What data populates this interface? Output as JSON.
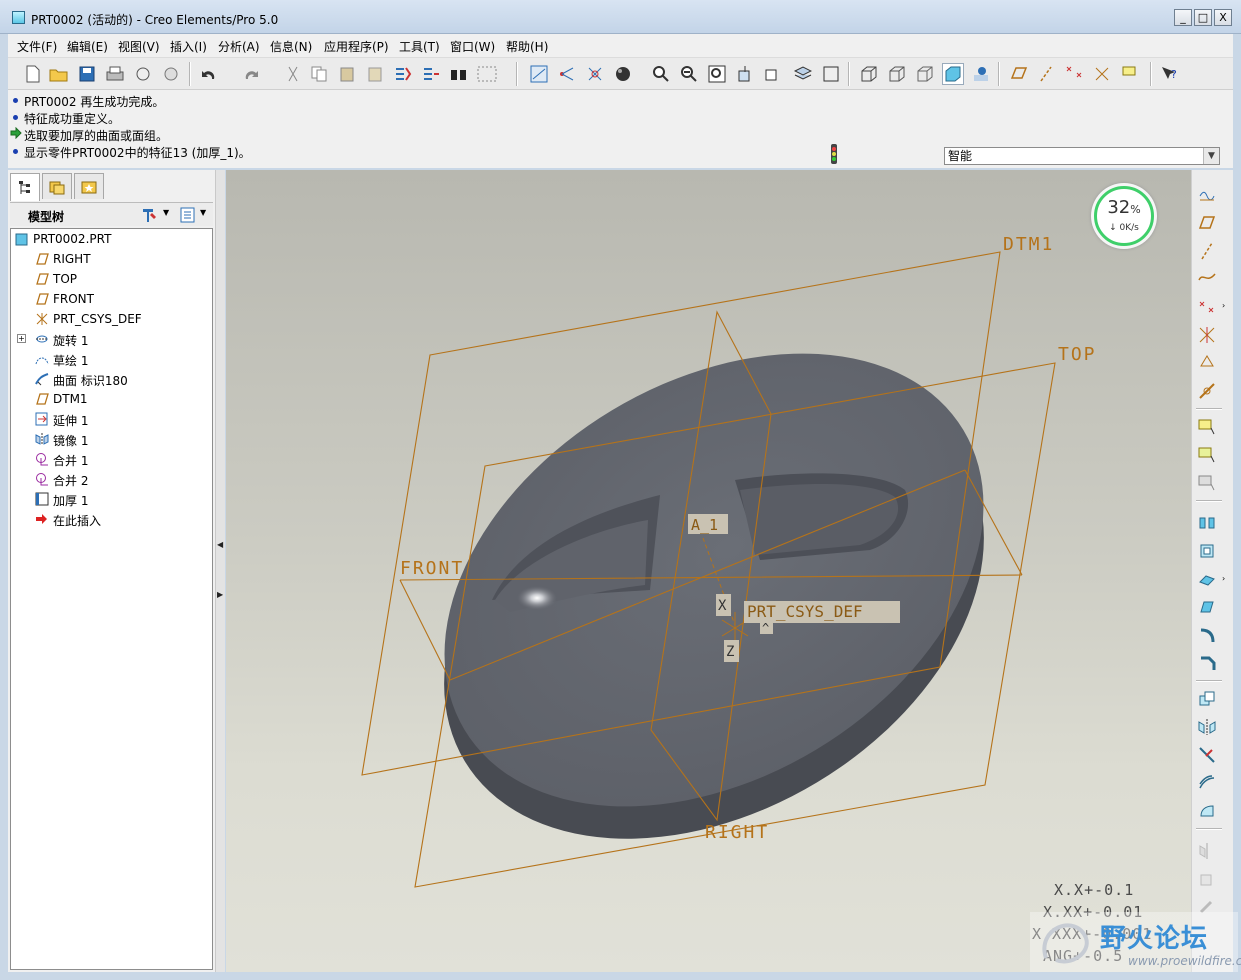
{
  "window": {
    "title": "PRT0002 (活动的) - Creo Elements/Pro 5.0",
    "controls": [
      "_",
      "□",
      "X"
    ]
  },
  "menubar": {
    "items": [
      "文件(F)",
      "编辑(E)",
      "视图(V)",
      "插入(I)",
      "分析(A)",
      "信息(N)",
      "应用程序(P)",
      "工具(T)",
      "窗口(W)",
      "帮助(H)"
    ]
  },
  "messages": [
    {
      "text": "PRT0002 再生成功完成。",
      "kind": "info"
    },
    {
      "text": "特征成功重定义。",
      "kind": "info"
    },
    {
      "text": "选取要加厚的曲面或面组。",
      "kind": "prompt"
    },
    {
      "text": "显示零件PRT0002中的特征13 (加厚_1)。",
      "kind": "info"
    }
  ],
  "selection_filter": {
    "value": "智能"
  },
  "model_tree": {
    "header": "模型树",
    "items": [
      {
        "label": "PRT0002.PRT",
        "icon": "part-icon"
      },
      {
        "label": "RIGHT",
        "icon": "datum-plane-icon"
      },
      {
        "label": "TOP",
        "icon": "datum-plane-icon"
      },
      {
        "label": "FRONT",
        "icon": "datum-plane-icon"
      },
      {
        "label": "PRT_CSYS_DEF",
        "icon": "csys-icon"
      },
      {
        "label": "旋转 1",
        "icon": "revolve-icon"
      },
      {
        "label": "草绘 1",
        "icon": "sketch-icon"
      },
      {
        "label": "曲面 标识180",
        "icon": "surface-icon"
      },
      {
        "label": "DTM1",
        "icon": "datum-plane-icon"
      },
      {
        "label": "延伸 1",
        "icon": "extend-icon"
      },
      {
        "label": "镜像 1",
        "icon": "mirror-icon"
      },
      {
        "label": "合并 1",
        "icon": "merge-icon"
      },
      {
        "label": "合并 2",
        "icon": "merge-icon"
      },
      {
        "label": "加厚 1",
        "icon": "thicken-icon"
      },
      {
        "label": "在此插入",
        "icon": "insert-here-icon"
      }
    ]
  },
  "viewport": {
    "labels": {
      "dtm1": "DTM1",
      "top": "TOP",
      "front": "FRONT",
      "right": "RIGHT",
      "axis": "A_1",
      "csys": "PRT_CSYS_DEF",
      "csys_x": "X",
      "csys_y": "^",
      "csys_z": "Z"
    },
    "tolerances": [
      "X.X+-0.1",
      "X.XX+-0.01",
      "X.XXX+-0.001",
      "ANG+-0.5"
    ],
    "datum_color": "#b5731a",
    "model_color": "#5e6168"
  },
  "net_widget": {
    "percent": "32",
    "percent_unit": "%",
    "speed": "↓ 0K/s"
  },
  "watermark": {
    "brand": "野火论坛",
    "url": "www.proewildfire.cn"
  }
}
